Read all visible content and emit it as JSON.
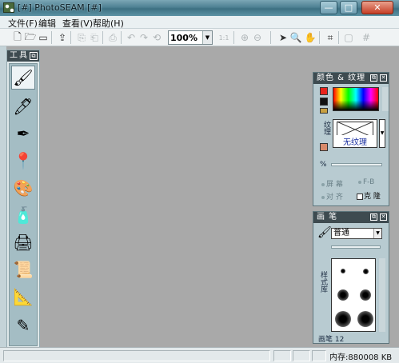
{
  "window": {
    "title": "[#] PhotoSEAM [#]",
    "min_label": "—",
    "max_label": "□",
    "close_label": "✕"
  },
  "menu": [
    {
      "label": "文件(F)"
    },
    {
      "label": "编辑"
    },
    {
      "label": "查看(V)"
    },
    {
      "label": "帮助(H)"
    }
  ],
  "toolbar": {
    "zoom_value": "100%",
    "ratio_label": "1:1",
    "icons": [
      "new-icon",
      "open-icon",
      "save-icon",
      "export-icon",
      "copy-icon",
      "paste-icon",
      "print-icon",
      "undo-icon",
      "redo-icon",
      "rotate-icon",
      "zoom-in-icon",
      "zoom-out-icon",
      "pointer-icon",
      "magnifier-icon",
      "hand-icon",
      "crop-icon",
      "frame-icon",
      "grid-icon"
    ]
  },
  "tool_palette": {
    "title": "工具",
    "tools": [
      "paintbrush-icon",
      "pen-icon",
      "airbrush-icon",
      "stamp-icon",
      "palette-icon",
      "paint-tube-icon",
      "printer-tool-icon",
      "scroll-icon",
      "pencil-ruler-icon",
      "brush-small-icon"
    ]
  },
  "color_panel": {
    "title": "颜色 & 纹理",
    "fg_color": "#e8241c",
    "bg_color": "#111111",
    "texture_side_label": "纹理",
    "texture_name": "无纹理",
    "percent_label": "%",
    "opt_screen": "屏 幕",
    "opt_f": "F-B",
    "opt_align": "对 齐",
    "opt_mirror": "克 隆"
  },
  "brush_panel": {
    "title": "画 笔",
    "mode": "普通",
    "style_side_label": "样式库",
    "size_label": "画笔 12",
    "brush_sizes": [
      6,
      7,
      14,
      14,
      20,
      20
    ]
  },
  "status": {
    "memory": "内存:880008 KB"
  }
}
